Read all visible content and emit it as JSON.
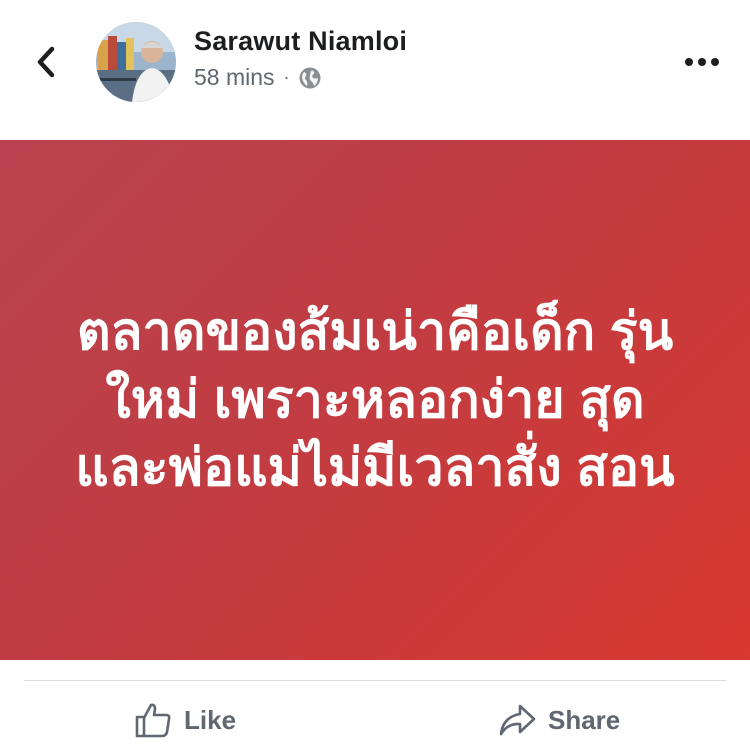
{
  "post": {
    "author_name": "Sarawut Niamloi",
    "time_ago": "58 mins",
    "separator": "·",
    "privacy_icon": "globe-icon",
    "text": "ตลาดของส้มเน่าคือเด็ก รุ่นใหม่ เพราะหลอกง่าย สุด และพ่อแม่ไม่มีเวลาสั่ง สอน",
    "background_colors": [
      "#b8434e",
      "#d7382f"
    ]
  },
  "header": {
    "back_icon": "chevron-left-icon",
    "more_icon": "more-horizontal-icon"
  },
  "actions": {
    "like_label": "Like",
    "like_icon": "thumbs-up-icon",
    "share_label": "Share",
    "share_icon": "share-arrow-icon"
  }
}
